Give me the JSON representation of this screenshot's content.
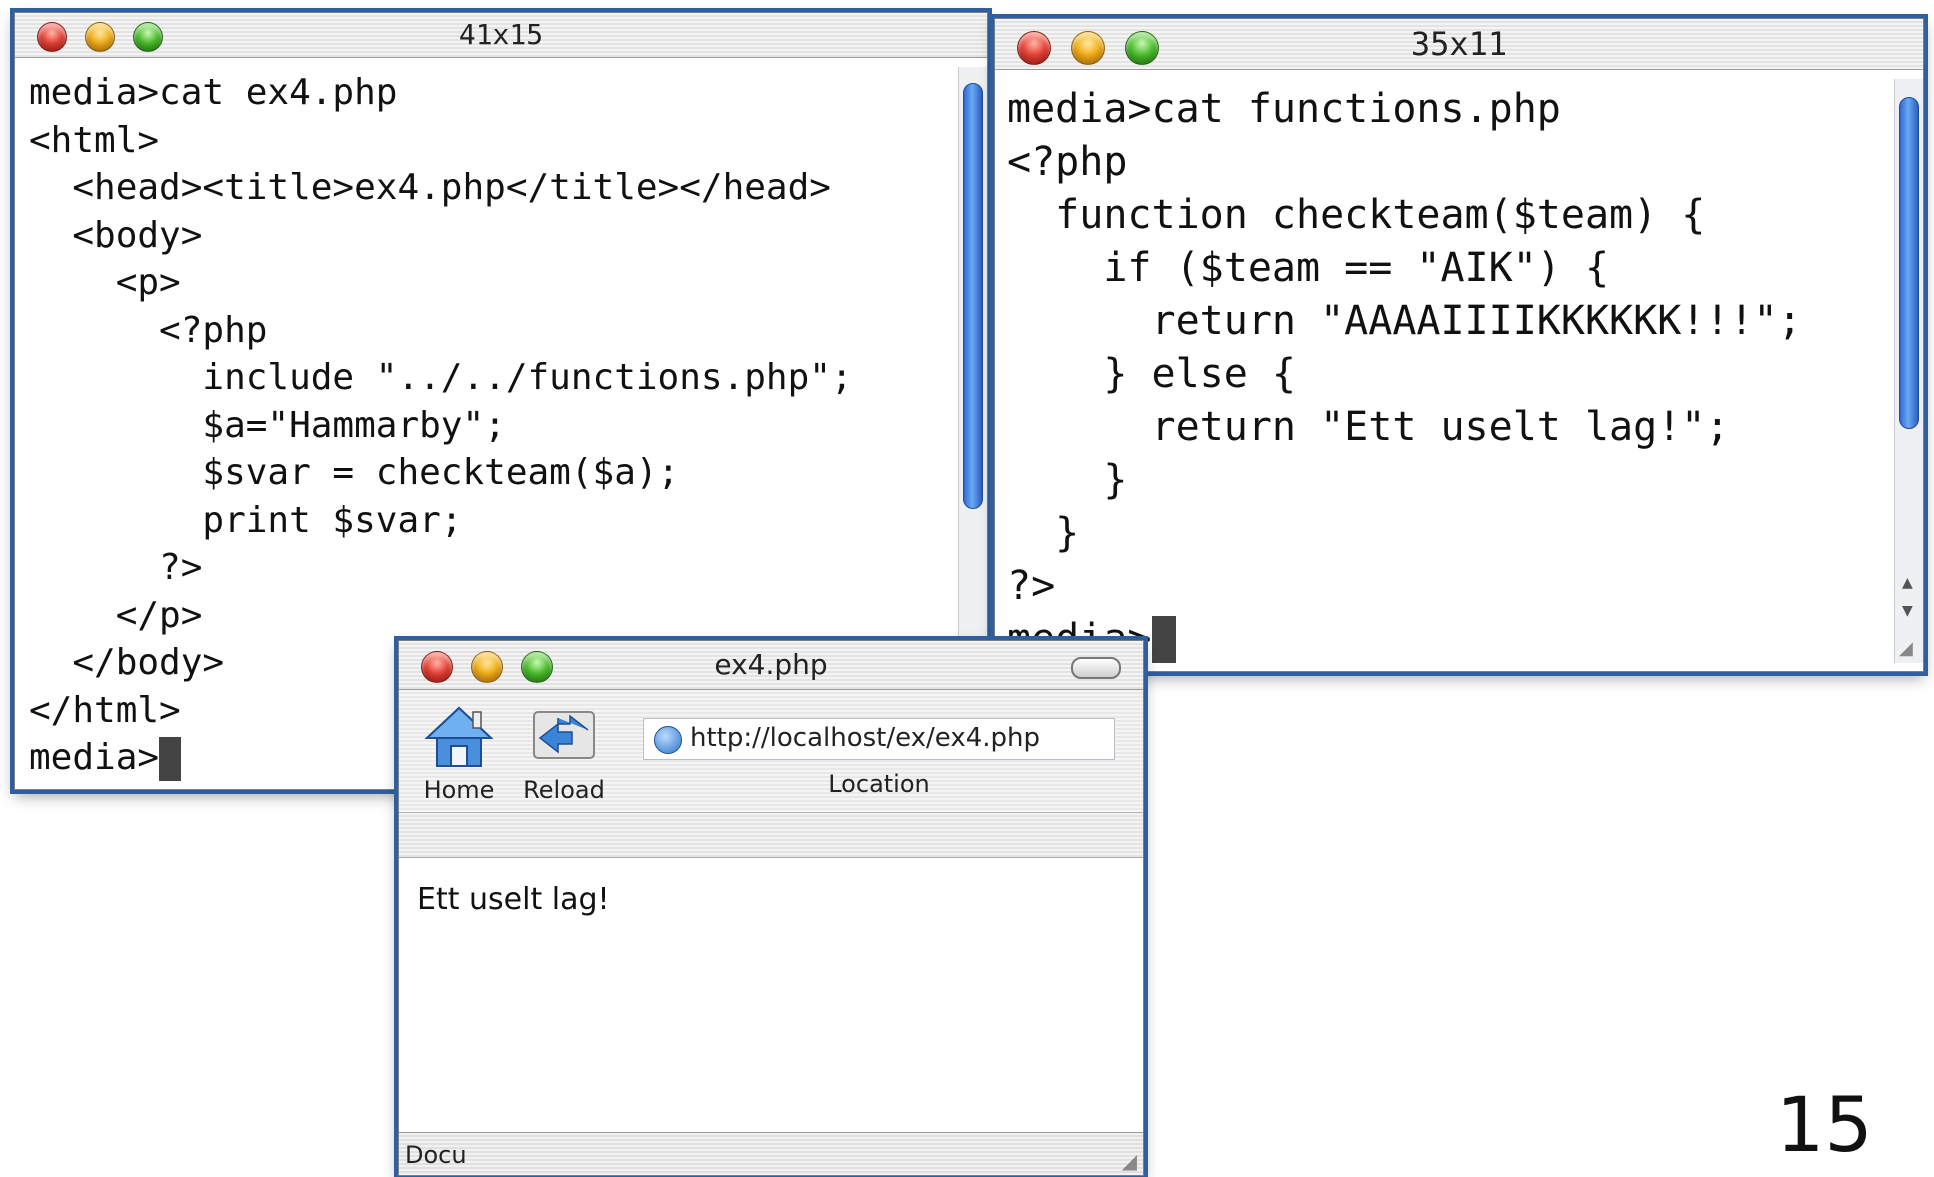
{
  "terminal_left": {
    "title": "41x15",
    "lines": [
      "media>cat ex4.php",
      "<html>",
      "  <head><title>ex4.php</title></head>",
      "  <body>",
      "    <p>",
      "      <?php",
      "        include \"../../functions.php\";",
      "        $a=\"Hammarby\";",
      "        $svar = checkteam($a);",
      "        print $svar;",
      "      ?>",
      "    </p>",
      "  </body>",
      "</html>",
      "media>"
    ]
  },
  "terminal_right": {
    "title": "35x11",
    "lines": [
      "media>cat functions.php",
      "<?php",
      "  function checkteam($team) {",
      "    if ($team == \"AIK\") {",
      "      return \"AAAAIIIIKKKKKK!!!\";",
      "    } else {",
      "      return \"Ett uselt lag!\";",
      "    }",
      "  }",
      "?>",
      "media>"
    ]
  },
  "browser": {
    "title": "ex4.php",
    "toolbar": {
      "home_label": "Home",
      "reload_label": "Reload",
      "location_label": "Location",
      "url": "http://localhost/ex/ex4.php"
    },
    "content_text": "Ett uselt lag!",
    "status_text": "Docu"
  },
  "page_number": "15",
  "icons": {
    "home": "home-icon",
    "reload": "reload-icon",
    "url": "globe-icon"
  },
  "colors": {
    "window_border": "#2f5f9e",
    "scroll_thumb": "#3d7fe0",
    "close": "#e9463a",
    "minimize": "#f5b31a",
    "zoom": "#4fc12f"
  }
}
